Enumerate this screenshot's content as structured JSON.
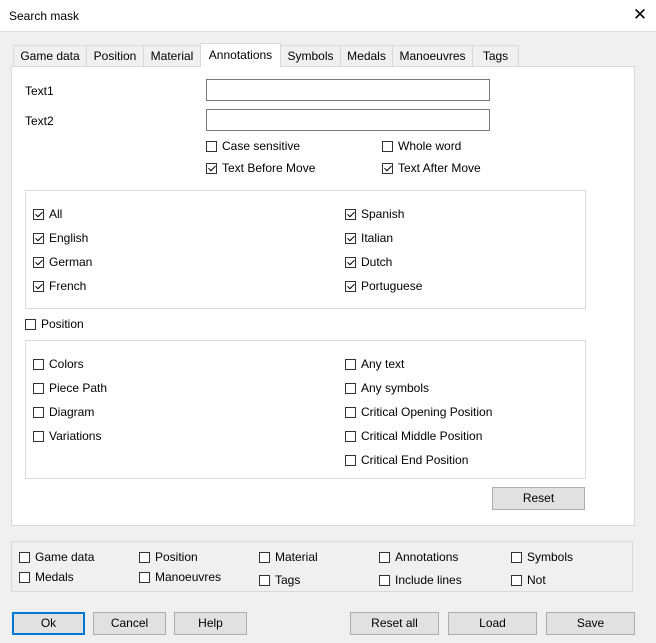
{
  "window": {
    "title": "Search mask",
    "close_glyph": "✕"
  },
  "tabs": [
    {
      "label": "Game data"
    },
    {
      "label": "Position"
    },
    {
      "label": "Material"
    },
    {
      "label": "Annotations"
    },
    {
      "label": "Symbols"
    },
    {
      "label": "Medals"
    },
    {
      "label": "Manoeuvres"
    },
    {
      "label": "Tags"
    }
  ],
  "active_tab": "Annotations",
  "text_fields": {
    "text1": {
      "label": "Text1",
      "value": ""
    },
    "text2": {
      "label": "Text2",
      "value": ""
    }
  },
  "text_options": {
    "case_sensitive": {
      "label": "Case sensitive",
      "checked": false
    },
    "whole_word": {
      "label": "Whole word",
      "checked": false
    },
    "text_before_move": {
      "label": "Text Before Move",
      "checked": true
    },
    "text_after_move": {
      "label": "Text After Move",
      "checked": true
    }
  },
  "languages": [
    {
      "label": "All",
      "checked": true
    },
    {
      "label": "English",
      "checked": true
    },
    {
      "label": "German",
      "checked": true
    },
    {
      "label": "French",
      "checked": true
    },
    {
      "label": "Spanish",
      "checked": true
    },
    {
      "label": "Italian",
      "checked": true
    },
    {
      "label": "Dutch",
      "checked": true
    },
    {
      "label": "Portuguese",
      "checked": true
    }
  ],
  "position": {
    "label": "Position",
    "checked": false
  },
  "position_options": [
    {
      "label": "Colors",
      "checked": false
    },
    {
      "label": "Piece Path",
      "checked": false
    },
    {
      "label": "Diagram",
      "checked": false
    },
    {
      "label": "Variations",
      "checked": false
    },
    {
      "label": "Any text",
      "checked": false
    },
    {
      "label": "Any symbols",
      "checked": false
    },
    {
      "label": "Critical Opening Position",
      "checked": false
    },
    {
      "label": "Critical Middle Position",
      "checked": false
    },
    {
      "label": "Critical End Position",
      "checked": false
    }
  ],
  "reset_label": "Reset",
  "filters": [
    {
      "label": "Game data",
      "checked": false
    },
    {
      "label": "Position",
      "checked": false
    },
    {
      "label": "Material",
      "checked": false
    },
    {
      "label": "Annotations",
      "checked": false
    },
    {
      "label": "Symbols",
      "checked": false
    },
    {
      "label": "Medals",
      "checked": false
    },
    {
      "label": "Manoeuvres",
      "checked": false
    },
    {
      "label": "Tags",
      "checked": false
    },
    {
      "label": "Include lines",
      "checked": false
    },
    {
      "label": "Not",
      "checked": false
    }
  ],
  "buttons": {
    "ok": "Ok",
    "cancel": "Cancel",
    "help": "Help",
    "reset_all": "Reset all",
    "load": "Load",
    "save": "Save"
  }
}
